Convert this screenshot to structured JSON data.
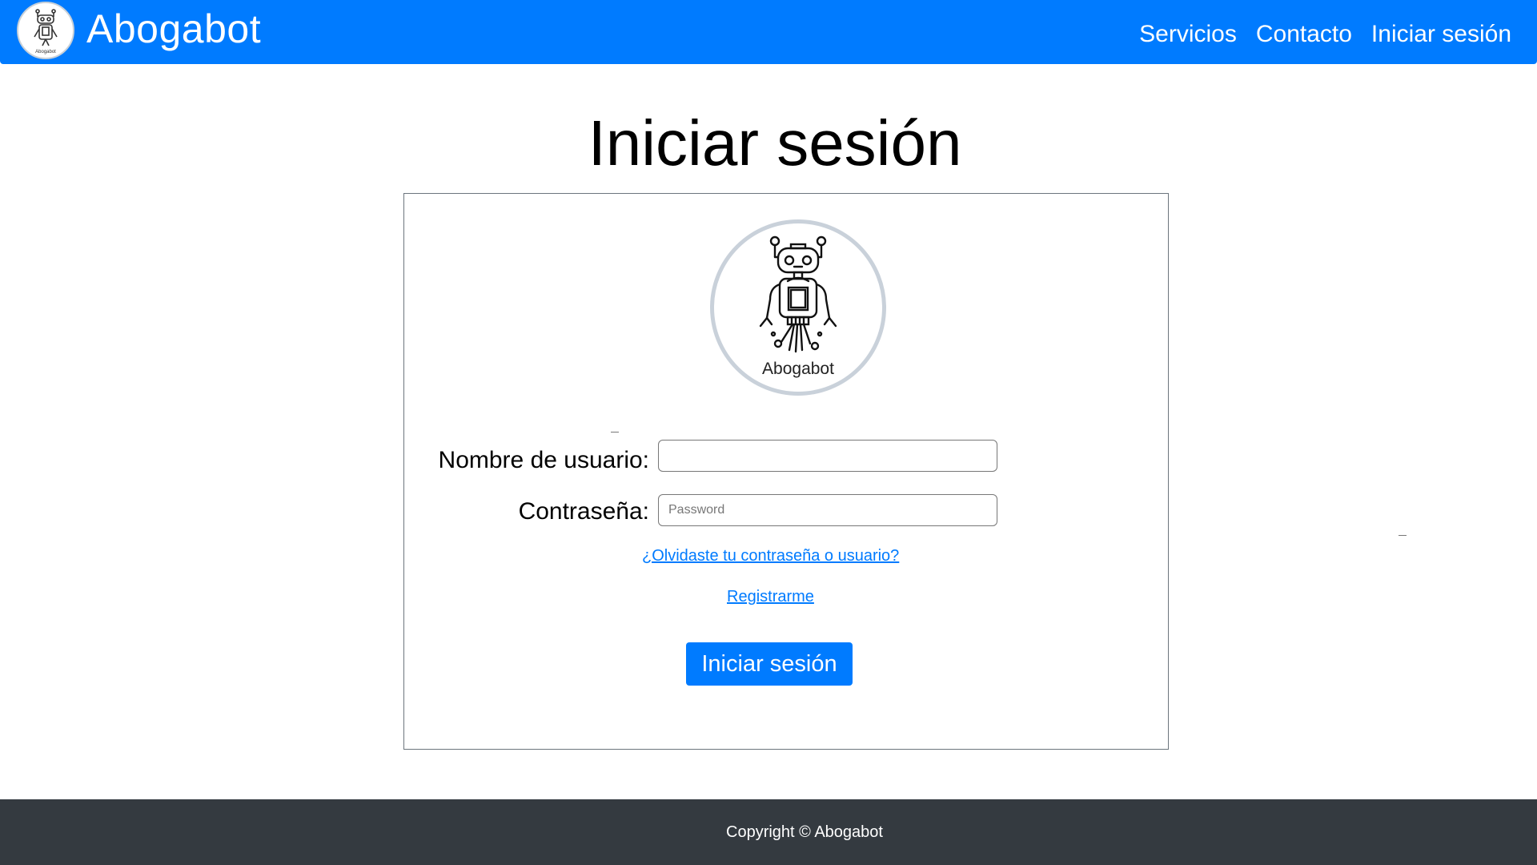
{
  "brand": {
    "name": "Abogabot",
    "logo_text": "Abogabot"
  },
  "nav": {
    "items": [
      {
        "label": "Servicios"
      },
      {
        "label": "Contacto"
      },
      {
        "label": "Iniciar sesión"
      }
    ]
  },
  "main": {
    "title": "Iniciar sesión",
    "logo_caption": "Abogabot"
  },
  "form": {
    "username": {
      "label": "Nombre de usuario:",
      "value": "",
      "placeholder": ""
    },
    "password": {
      "label": "Contraseña:",
      "value": "",
      "placeholder": "Password"
    },
    "forgot_link": "¿Olvidaste tu contraseña o usuario? ",
    "register_link": "Registrarme",
    "submit_label": "Iniciar sesión"
  },
  "footer": {
    "copyright": "Copyright © Abogabot"
  },
  "colors": {
    "primary": "#007bff",
    "footer_bg": "#343a40",
    "card_border": "#6c757d"
  }
}
